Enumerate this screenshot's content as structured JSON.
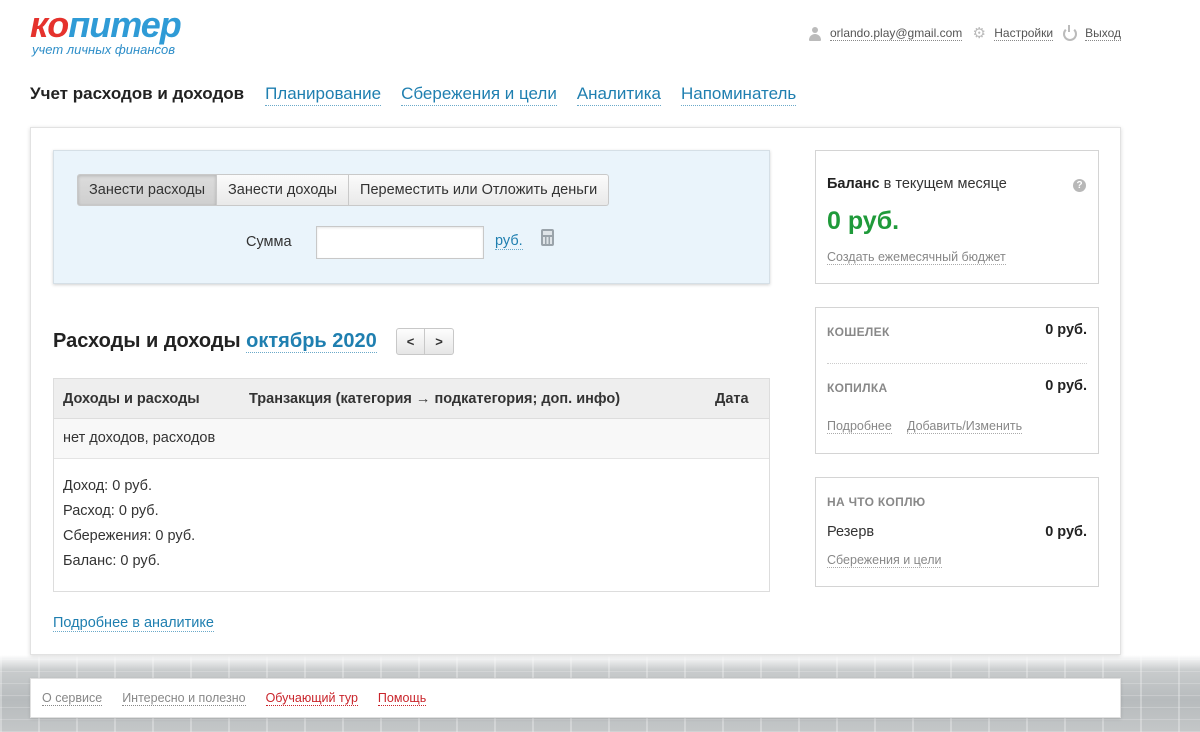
{
  "logo": {
    "part1": "ко",
    "part2": "питер",
    "tagline": "учет личных финансов"
  },
  "userbar": {
    "email": "orlando.play@gmail.com",
    "settings": "Настройки",
    "logout": "Выход"
  },
  "nav": {
    "active": "Учет расходов и доходов",
    "items": [
      "Планирование",
      "Сбережения и цели",
      "Аналитика",
      "Напоминатель"
    ]
  },
  "entry": {
    "tabs": [
      "Занести расходы",
      "Занести доходы",
      "Переместить или Отложить деньги"
    ],
    "active_tab": 0,
    "sum_label": "Сумма",
    "sum_value": "",
    "currency": "руб."
  },
  "section": {
    "title": "Расходы и доходы",
    "month": "октябрь 2020",
    "prev": "<",
    "next": ">"
  },
  "table": {
    "headers": [
      "Доходы и расходы",
      "Транзакция (категория → подкатегория; доп. инфо)",
      "Дата"
    ],
    "empty": "нет доходов, расходов",
    "totals": [
      "Доход: 0 руб.",
      "Расход: 0 руб.",
      "Сбережения: 0 руб.",
      "Баланс: 0 руб."
    ]
  },
  "more_link": "Подробнее в аналитике",
  "balance": {
    "title_bold": "Баланс",
    "title_rest": " в текущем месяце",
    "help": "?",
    "amount": "0 руб.",
    "link": "Создать ежемесячный бюджет",
    "amount_color": "#1f9a3a"
  },
  "accounts": {
    "wallet_label": "КОШЕЛЕК",
    "wallet_value": "0 руб.",
    "piggy_label": "КОПИЛКА",
    "piggy_value": "0 руб.",
    "link_more": "Подробнее",
    "link_edit": "Добавить/Изменить"
  },
  "goals": {
    "label": "НА ЧТО КОПЛЮ",
    "item_name": "Резерв",
    "item_value": "0 руб.",
    "link": "Сбережения и цели"
  },
  "footer": [
    "О сервисе",
    "Интересно и полезно",
    "Обучающий тур",
    "Помощь"
  ]
}
